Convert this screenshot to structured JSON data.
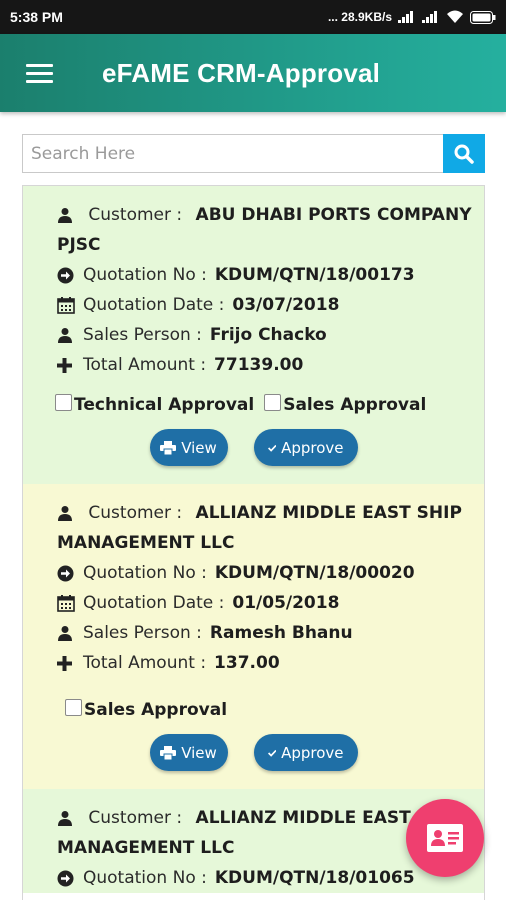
{
  "status_bar": {
    "time": "5:38 PM",
    "network_speed": "... 28.9KB/s",
    "battery_icon": "battery-icon",
    "wifi_icon": "wifi-icon"
  },
  "app_bar": {
    "title": "eFAME CRM-Approval",
    "menu_icon": "hamburger-menu-icon"
  },
  "search": {
    "placeholder": "Search Here",
    "value": "",
    "icon": "search-icon"
  },
  "colors": {
    "accent": "#1b7f6d",
    "search_button": "#10a9e6",
    "pill_button": "#1f6fa6",
    "fab": "#ef3f6f",
    "card_green": "#e6f8d9",
    "card_yellow": "#f8f9d3"
  },
  "quotations": [
    {
      "customer_label": "Customer :",
      "customer": "ABU DHABI PORTS COMPANY PJSC",
      "quotation_no_label": "Quotation No :",
      "quotation_no": "KDUM/QTN/18/00173",
      "quotation_date_label": "Quotation Date :",
      "quotation_date": "03/07/2018",
      "sales_person_label": "Sales Person :",
      "sales_person": "Frijo Chacko",
      "total_amount_label": "Total Amount :",
      "total_amount": "77139.00",
      "approvals": [
        "Technical Approval",
        "Sales Approval"
      ],
      "view_label": "View",
      "approve_label": "Approve"
    },
    {
      "customer_label": "Customer :",
      "customer": "ALLIANZ MIDDLE EAST SHIP MANAGEMENT LLC",
      "quotation_no_label": "Quotation No :",
      "quotation_no": "KDUM/QTN/18/00020",
      "quotation_date_label": "Quotation Date :",
      "quotation_date": "01/05/2018",
      "sales_person_label": "Sales Person :",
      "sales_person": "Ramesh Bhanu",
      "total_amount_label": "Total Amount :",
      "total_amount": "137.00",
      "approvals": [
        "Sales Approval"
      ],
      "view_label": "View",
      "approve_label": "Approve"
    },
    {
      "customer_label": "Customer :",
      "customer": "ALLIANZ MIDDLE EAST SHIP MANAGEMENT LLC",
      "quotation_no_label": "Quotation No :",
      "quotation_no": "KDUM/QTN/18/01065"
    }
  ],
  "fab": {
    "icon": "contact-card-icon"
  }
}
